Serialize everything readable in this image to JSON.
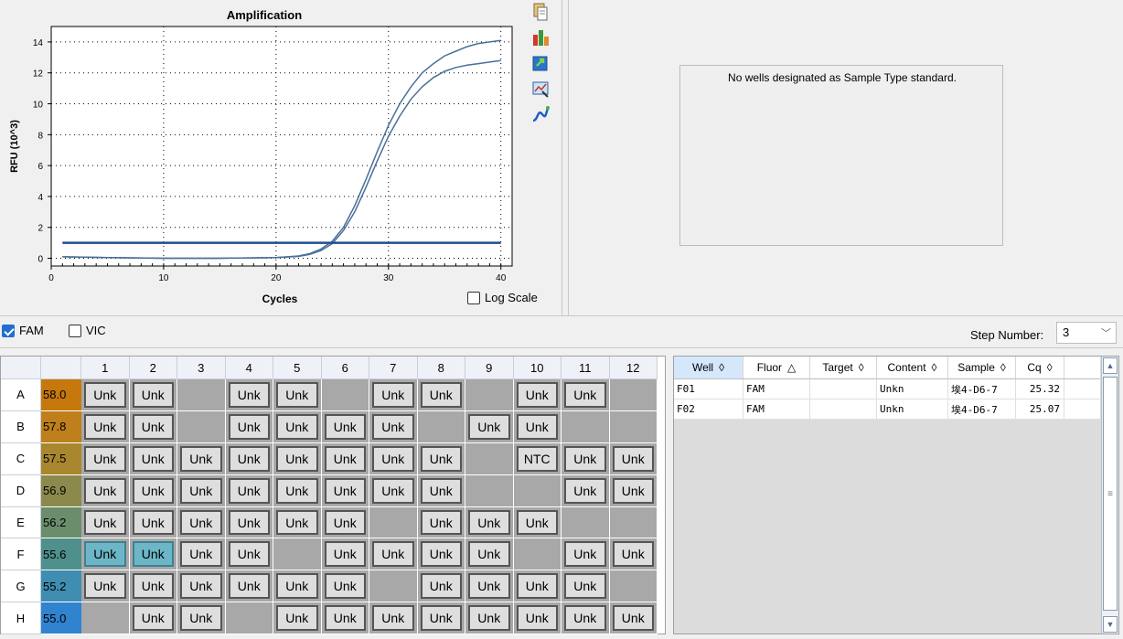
{
  "chart": {
    "title": "Amplification",
    "xlabel": "Cycles",
    "ylabel": "RFU (10^3)",
    "log_scale_label": "Log Scale",
    "log_scale_checked": false
  },
  "chart_data": {
    "type": "line",
    "title": "Amplification",
    "xlabel": "Cycles",
    "ylabel": "RFU (10^3)",
    "xlim": [
      0,
      41
    ],
    "ylim": [
      -0.5,
      15
    ],
    "xticks": [
      0,
      10,
      20,
      30,
      40
    ],
    "yticks": [
      0,
      2,
      4,
      6,
      8,
      10,
      12,
      14
    ],
    "grid": "dotted",
    "threshold": 1.0,
    "series": [
      {
        "x": [
          1,
          5,
          10,
          15,
          20,
          22,
          23,
          24,
          25,
          26,
          27,
          28,
          29,
          30,
          31,
          32,
          33,
          34,
          35,
          36,
          37,
          38,
          39,
          40
        ],
        "y": [
          0.1,
          0.05,
          0.0,
          0.0,
          0.05,
          0.15,
          0.3,
          0.6,
          1.1,
          2.0,
          3.4,
          5.1,
          6.9,
          8.6,
          10.0,
          11.1,
          12.0,
          12.6,
          13.1,
          13.4,
          13.7,
          13.9,
          14.0,
          14.1
        ]
      },
      {
        "x": [
          1,
          5,
          10,
          15,
          20,
          22,
          23,
          24,
          25,
          26,
          27,
          28,
          29,
          30,
          31,
          32,
          33,
          34,
          35,
          36,
          37,
          38,
          39,
          40
        ],
        "y": [
          0.1,
          0.05,
          0.0,
          0.0,
          0.05,
          0.12,
          0.25,
          0.5,
          0.95,
          1.8,
          3.0,
          4.6,
          6.3,
          7.9,
          9.2,
          10.3,
          11.1,
          11.7,
          12.1,
          12.35,
          12.5,
          12.6,
          12.7,
          12.8
        ]
      }
    ]
  },
  "toolbar_icons": [
    "copy-icon",
    "color-chart-icon",
    "export-icon",
    "zoom-chart-icon",
    "curve-fit-icon"
  ],
  "standard_curve": {
    "message": "No wells designated as Sample Type standard."
  },
  "fluors": [
    {
      "label": "FAM",
      "checked": true
    },
    {
      "label": "VIC",
      "checked": false
    }
  ],
  "step": {
    "label": "Step Number:",
    "value": "3"
  },
  "plate": {
    "columns": [
      "1",
      "2",
      "3",
      "4",
      "5",
      "6",
      "7",
      "8",
      "9",
      "10",
      "11",
      "12"
    ],
    "rows": [
      {
        "label": "A",
        "temp": "58.0",
        "temp_color": "#c6780c",
        "wells": [
          "Unk",
          "Unk",
          "",
          "Unk",
          "Unk",
          "",
          "Unk",
          "Unk",
          "",
          "Unk",
          "Unk",
          ""
        ]
      },
      {
        "label": "B",
        "temp": "57.8",
        "temp_color": "#bf7f1a",
        "wells": [
          "Unk",
          "Unk",
          "",
          "Unk",
          "Unk",
          "Unk",
          "Unk",
          "",
          "Unk",
          "Unk",
          "",
          ""
        ]
      },
      {
        "label": "C",
        "temp": "57.5",
        "temp_color": "#a8872e",
        "wells": [
          "Unk",
          "Unk",
          "Unk",
          "Unk",
          "Unk",
          "Unk",
          "Unk",
          "Unk",
          "",
          "NTC",
          "Unk",
          "Unk"
        ]
      },
      {
        "label": "D",
        "temp": "56.9",
        "temp_color": "#8b8a4c",
        "wells": [
          "Unk",
          "Unk",
          "Unk",
          "Unk",
          "Unk",
          "Unk",
          "Unk",
          "Unk",
          "",
          "",
          "Unk",
          "Unk"
        ]
      },
      {
        "label": "E",
        "temp": "56.2",
        "temp_color": "#6b8d6c",
        "wells": [
          "Unk",
          "Unk",
          "Unk",
          "Unk",
          "Unk",
          "Unk",
          "",
          "Unk",
          "Unk",
          "Unk",
          "",
          ""
        ]
      },
      {
        "label": "F",
        "temp": "55.6",
        "temp_color": "#4f8f8c",
        "wells": [
          "Unk",
          "Unk",
          "Unk",
          "Unk",
          "",
          "Unk",
          "Unk",
          "Unk",
          "Unk",
          "",
          "Unk",
          "Unk"
        ],
        "selected": [
          0,
          1
        ]
      },
      {
        "label": "G",
        "temp": "55.2",
        "temp_color": "#3f8db0",
        "wells": [
          "Unk",
          "Unk",
          "Unk",
          "Unk",
          "Unk",
          "Unk",
          "",
          "Unk",
          "Unk",
          "Unk",
          "Unk",
          ""
        ]
      },
      {
        "label": "H",
        "temp": "55.0",
        "temp_color": "#2f83cf",
        "wells": [
          "",
          "Unk",
          "Unk",
          "",
          "Unk",
          "Unk",
          "Unk",
          "Unk",
          "Unk",
          "Unk",
          "Unk",
          "Unk"
        ]
      }
    ]
  },
  "table": {
    "columns": [
      {
        "label": "Well",
        "sort": "◊",
        "sorted": true
      },
      {
        "label": "Fluor",
        "sort": "△",
        "sorted": false
      },
      {
        "label": "Target",
        "sort": "◊",
        "sorted": false
      },
      {
        "label": "Content",
        "sort": "◊",
        "sorted": false
      },
      {
        "label": "Sample",
        "sort": "◊",
        "sorted": false
      },
      {
        "label": "Cq",
        "sort": "◊",
        "sorted": false
      }
    ],
    "rows": [
      {
        "well": "F01",
        "fluor": "FAM",
        "target": "",
        "content": "Unkn",
        "sample": "埃4-D6-7",
        "cq": "25.32"
      },
      {
        "well": "F02",
        "fluor": "FAM",
        "target": "",
        "content": "Unkn",
        "sample": "埃4-D6-7",
        "cq": "25.07"
      }
    ]
  }
}
